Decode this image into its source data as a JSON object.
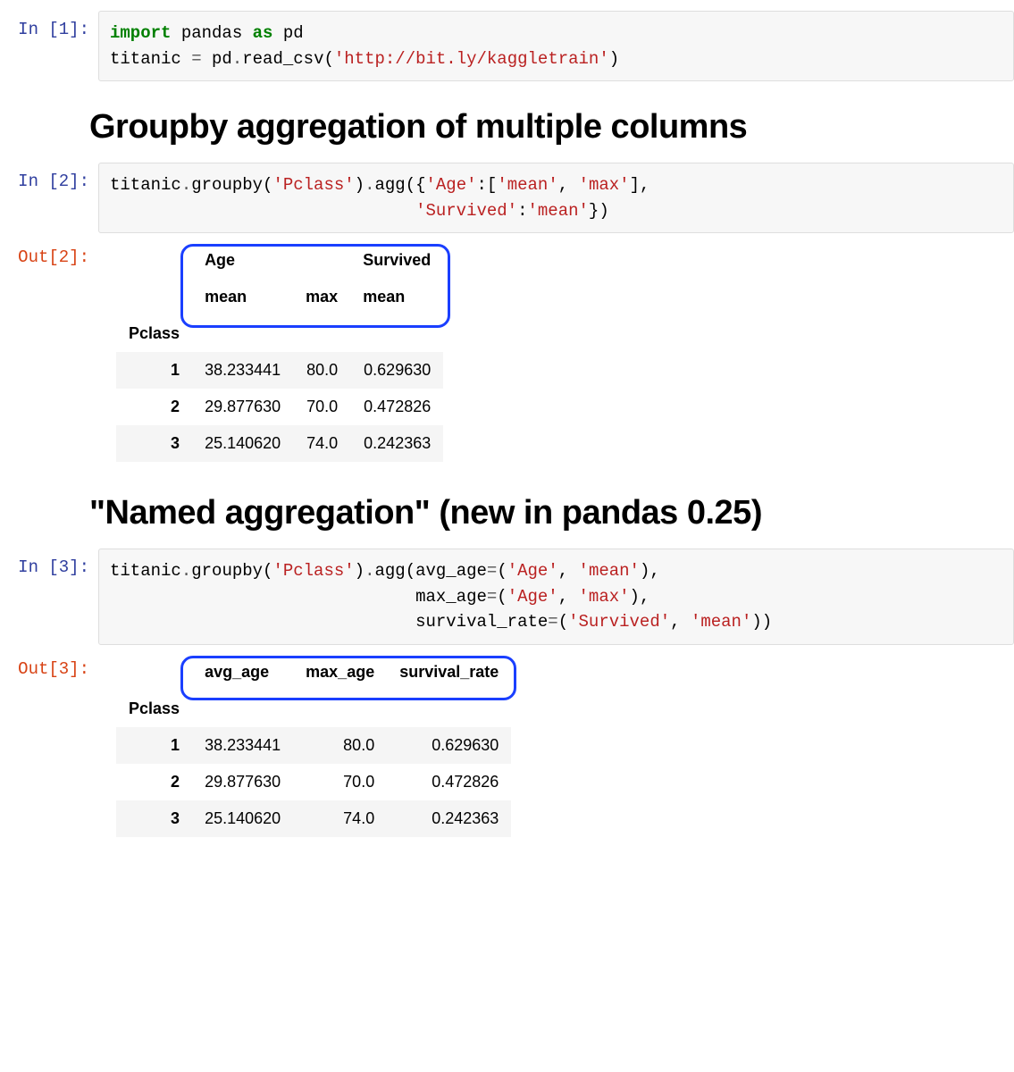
{
  "cells": {
    "in1_prompt": "In [1]:",
    "in2_prompt": "In [2]:",
    "in3_prompt": "In [3]:",
    "out2_prompt": "Out[2]:",
    "out3_prompt": "Out[3]:"
  },
  "code1": {
    "kw_import": "import",
    "mod": " pandas ",
    "kw_as": "as",
    "alias": " pd",
    "line2a": "titanic ",
    "eq": "=",
    "line2b": " pd",
    "dot": ".",
    "fn": "read_csv(",
    "url": "'http://bit.ly/kaggletrain'",
    "close": ")"
  },
  "heading1": "Groupby aggregation of multiple columns",
  "code2": {
    "a": "titanic",
    "dot1": ".",
    "b": "groupby(",
    "s1": "'Pclass'",
    "c": ")",
    "dot2": ".",
    "d": "agg({",
    "s2": "'Age'",
    "e": ":[",
    "s3": "'mean'",
    "f": ", ",
    "s4": "'max'",
    "g": "],",
    "indent": "                              ",
    "s5": "'Survived'",
    "h": ":",
    "s6": "'mean'",
    "i": "})"
  },
  "table1": {
    "top1": "Age",
    "top2": "Survived",
    "sub1": "mean",
    "sub2": "max",
    "sub3": "mean",
    "indexname": "Pclass",
    "rows": [
      {
        "idx": "1",
        "c0": "38.233441",
        "c1": "80.0",
        "c2": "0.629630"
      },
      {
        "idx": "2",
        "c0": "29.877630",
        "c1": "70.0",
        "c2": "0.472826"
      },
      {
        "idx": "3",
        "c0": "25.140620",
        "c1": "74.0",
        "c2": "0.242363"
      }
    ]
  },
  "heading2": "\"Named aggregation\" (new in pandas 0.25)",
  "code3": {
    "a": "titanic",
    "dot1": ".",
    "b": "groupby(",
    "s1": "'Pclass'",
    "c": ")",
    "dot2": ".",
    "d": "agg(avg_age",
    "eq1": "=",
    "e": "(",
    "s2": "'Age'",
    "f": ", ",
    "s3": "'mean'",
    "g": "),",
    "indent": "                              ",
    "h": "max_age",
    "eq2": "=",
    "i": "(",
    "s4": "'Age'",
    "j": ", ",
    "s5": "'max'",
    "k": "),",
    "l": "survival_rate",
    "eq3": "=",
    "m": "(",
    "s6": "'Survived'",
    "n": ", ",
    "s7": "'mean'",
    "o": "))"
  },
  "table2": {
    "h1": "avg_age",
    "h2": "max_age",
    "h3": "survival_rate",
    "indexname": "Pclass",
    "rows": [
      {
        "idx": "1",
        "c0": "38.233441",
        "c1": "80.0",
        "c2": "0.629630"
      },
      {
        "idx": "2",
        "c0": "29.877630",
        "c1": "70.0",
        "c2": "0.472826"
      },
      {
        "idx": "3",
        "c0": "25.140620",
        "c1": "74.0",
        "c2": "0.242363"
      }
    ]
  },
  "chart_data": [
    {
      "type": "table",
      "title": "Groupby aggregation of multiple columns",
      "index_name": "Pclass",
      "columns": [
        [
          "Age",
          "mean"
        ],
        [
          "Age",
          "max"
        ],
        [
          "Survived",
          "mean"
        ]
      ],
      "index": [
        1,
        2,
        3
      ],
      "data": [
        [
          38.233441,
          80.0,
          0.62963
        ],
        [
          29.87763,
          70.0,
          0.472826
        ],
        [
          25.14062,
          74.0,
          0.242363
        ]
      ]
    },
    {
      "type": "table",
      "title": "Named aggregation (new in pandas 0.25)",
      "index_name": "Pclass",
      "columns": [
        "avg_age",
        "max_age",
        "survival_rate"
      ],
      "index": [
        1,
        2,
        3
      ],
      "data": [
        [
          38.233441,
          80.0,
          0.62963
        ],
        [
          29.87763,
          70.0,
          0.472826
        ],
        [
          25.14062,
          74.0,
          0.242363
        ]
      ]
    }
  ]
}
